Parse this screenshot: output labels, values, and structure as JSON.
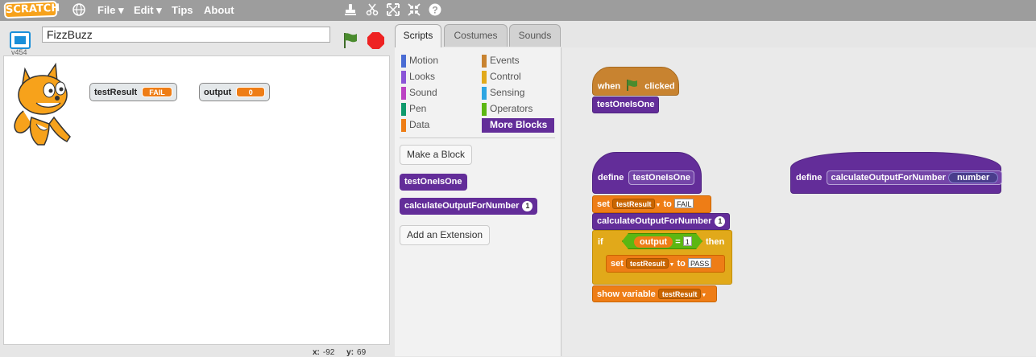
{
  "menubar": {
    "logo": "SCRATCH",
    "file": "File ▾",
    "edit": "Edit ▾",
    "tips": "Tips",
    "about": "About"
  },
  "stage": {
    "title": "FizzBuzz",
    "version": "v454",
    "monitors": [
      {
        "name": "testResult",
        "value": "FAIL"
      },
      {
        "name": "output",
        "value": "0"
      }
    ],
    "x_label": "x:",
    "x": "-92",
    "y_label": "y:",
    "y": "69"
  },
  "tabs": [
    "Scripts",
    "Costumes",
    "Sounds"
  ],
  "categories": {
    "left": [
      {
        "label": "Motion",
        "color": "#4a6cd4"
      },
      {
        "label": "Looks",
        "color": "#8a55d7"
      },
      {
        "label": "Sound",
        "color": "#bb42c3"
      },
      {
        "label": "Pen",
        "color": "#0e9a6c"
      },
      {
        "label": "Data",
        "color": "#ee7d16"
      }
    ],
    "right": [
      {
        "label": "Events",
        "color": "#c88330"
      },
      {
        "label": "Control",
        "color": "#e1a91a"
      },
      {
        "label": "Sensing",
        "color": "#2ca5e2"
      },
      {
        "label": "Operators",
        "color": "#5cb712"
      },
      {
        "label": "More Blocks",
        "color": "#632d99"
      }
    ]
  },
  "palette": {
    "make_block": "Make a Block",
    "block1": "testOneIsOne",
    "block2": "calculateOutputForNumber",
    "block2_arg": "1",
    "add_extension": "Add an Extension"
  },
  "scripts": {
    "when_label": "when",
    "clicked_label": "clicked",
    "call_test": "testOneIsOne",
    "define_label": "define",
    "define_name": "testOneIsOne",
    "set_label": "set",
    "set_var": "testResult",
    "to_label": "to",
    "set_value_fail": "FAIL",
    "calc_block": "calculateOutputForNumber",
    "calc_arg": "1",
    "if_label": "if",
    "output_reporter": "output",
    "equals": "=",
    "compare_value": "1",
    "then_label": "then",
    "set_value_pass": "PASS",
    "show_label": "show variable",
    "show_var": "testResult",
    "define2_label": "define",
    "define2_name": "calculateOutputForNumber",
    "define2_param": "number"
  }
}
